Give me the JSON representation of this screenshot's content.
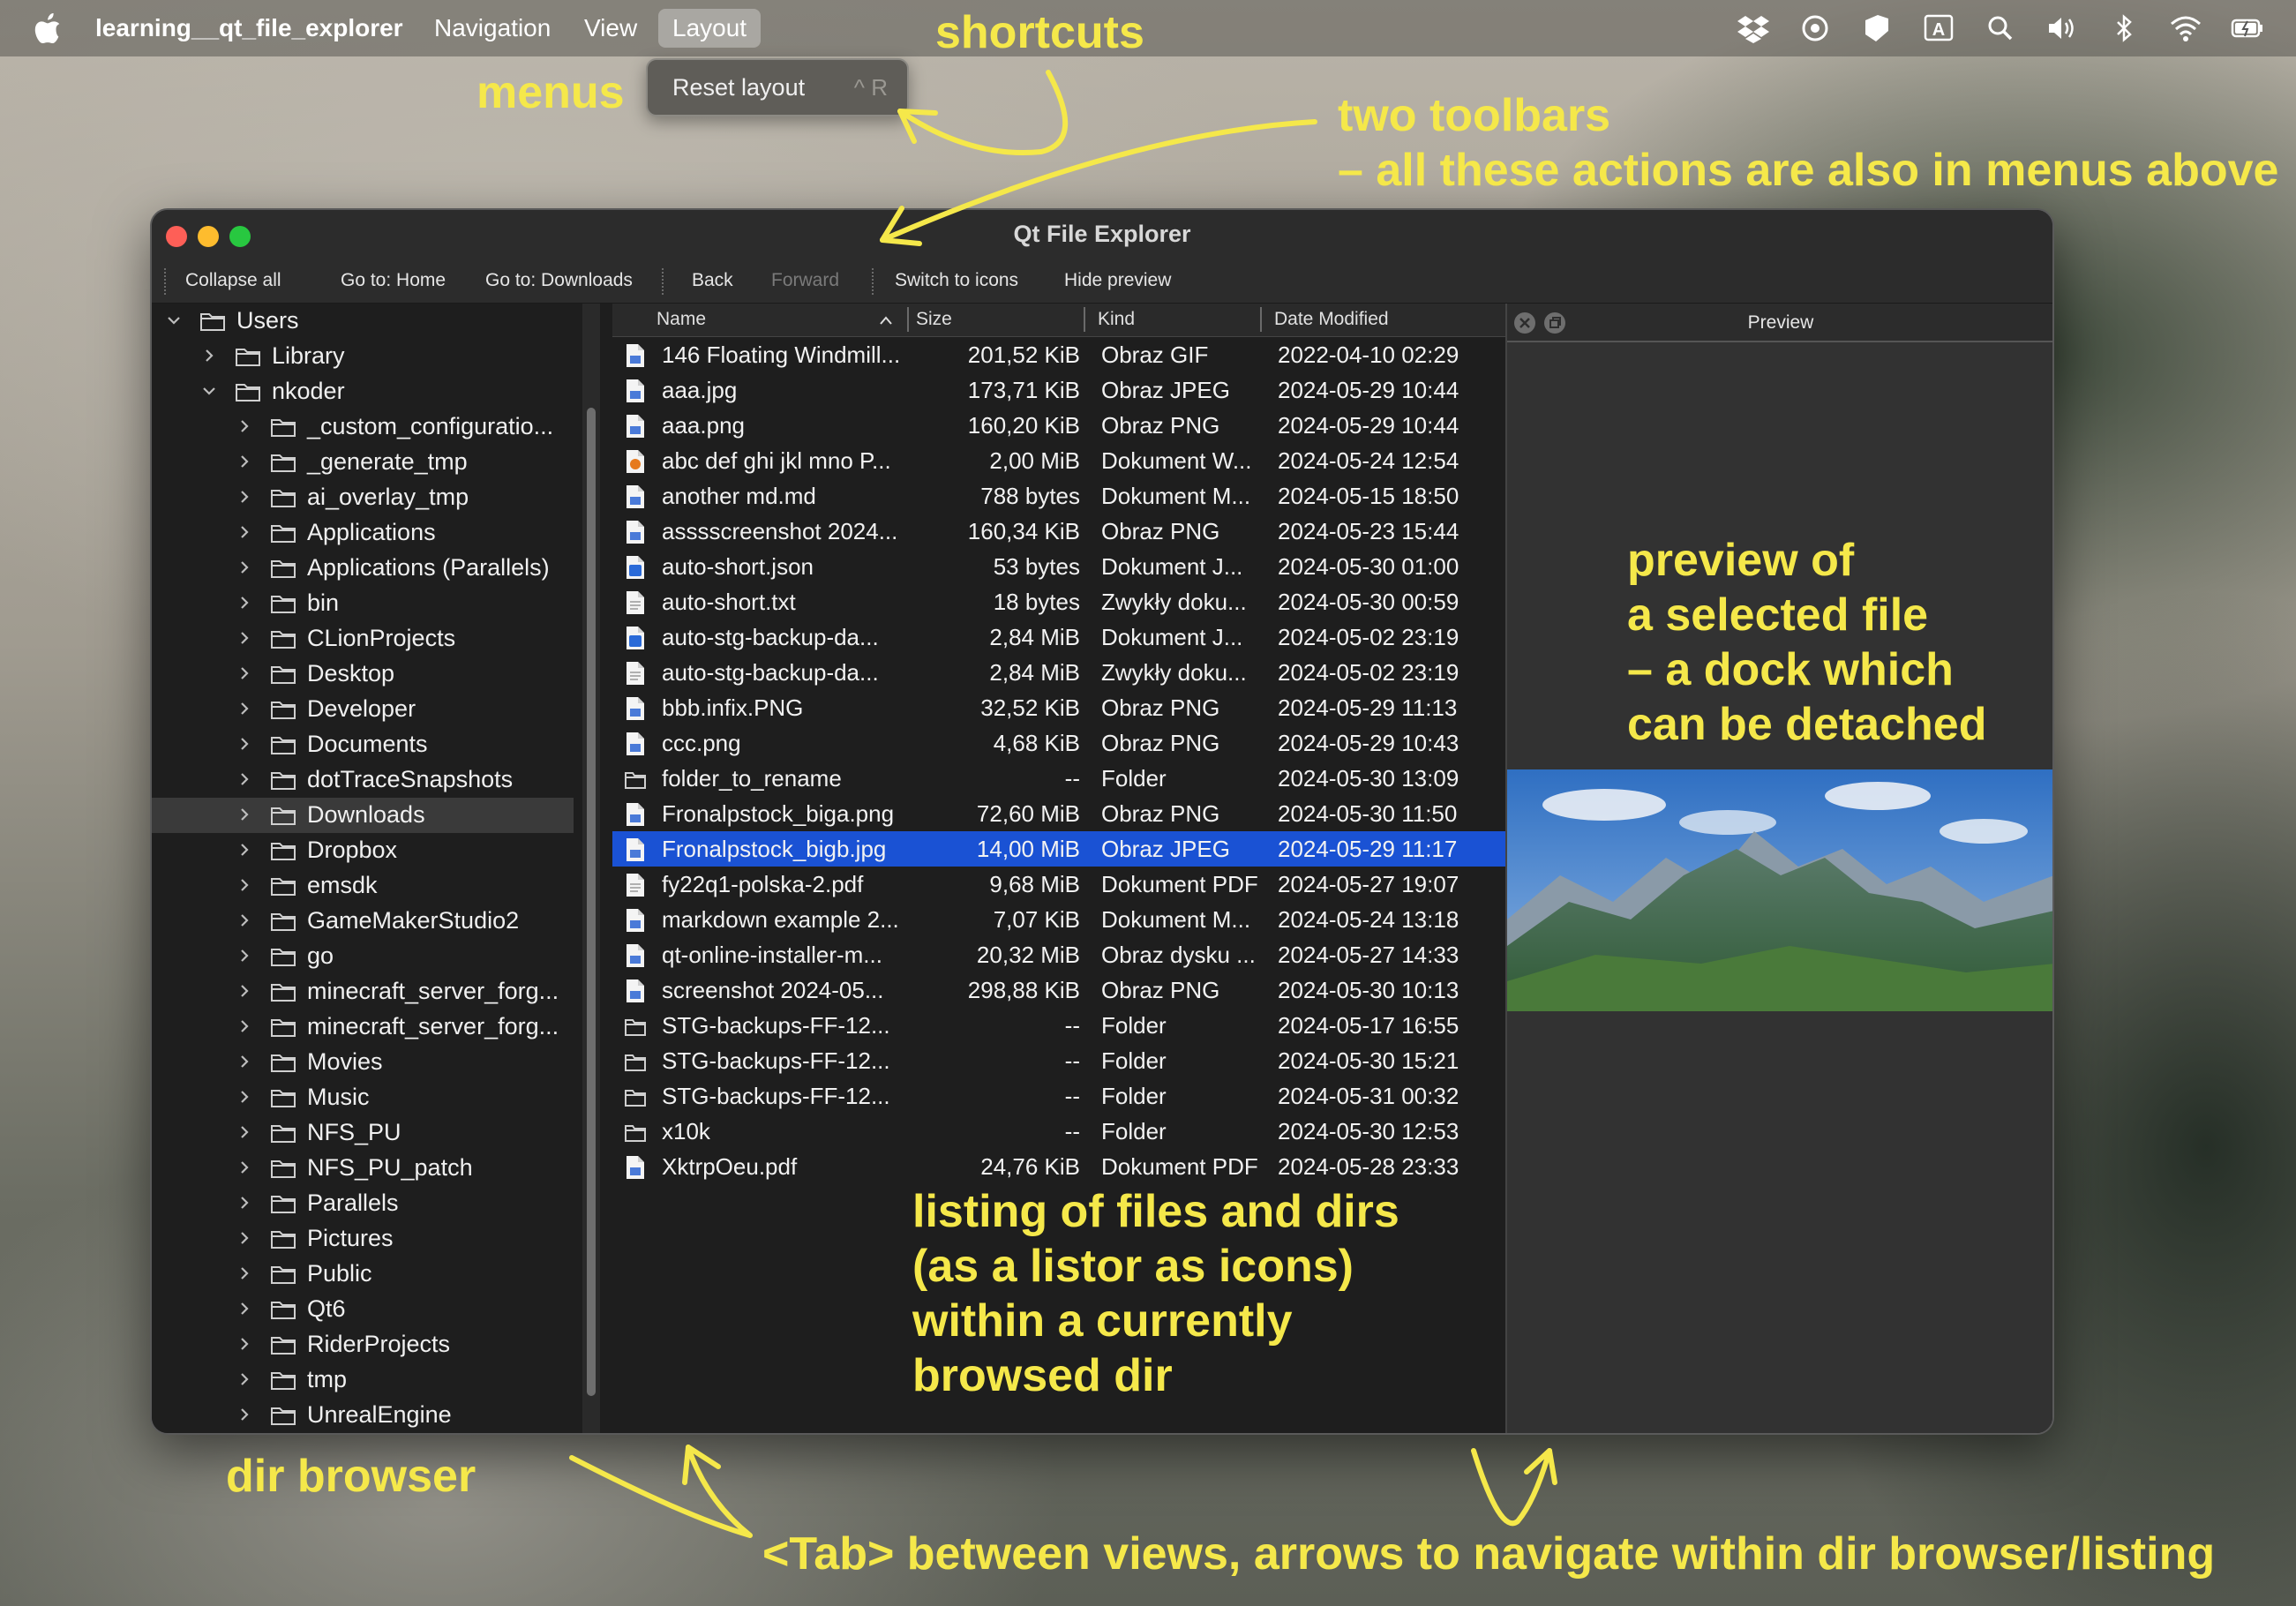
{
  "menubar": {
    "app_name": "learning__qt_file_explorer",
    "items": [
      "Navigation",
      "View",
      "Layout"
    ],
    "active_item": "Layout"
  },
  "dropdown": {
    "item_label": "Reset layout",
    "shortcut": "^ R"
  },
  "annotations": {
    "shortcuts": "shortcuts",
    "menus": "menus",
    "toolbars_line1": "two toolbars",
    "toolbars_line2": "– all these actions are also in menus above",
    "preview_lines": [
      "preview of",
      "a selected file",
      "– a dock which",
      "can be detached"
    ],
    "listing_lines": [
      "listing of files and dirs",
      "(as a listor as icons)",
      "within a currently",
      "browsed dir"
    ],
    "dir_browser": "dir browser",
    "tab_hint": "<Tab> between views, arrows to navigate within dir browser/listing"
  },
  "window": {
    "title": "Qt File Explorer",
    "toolbar1": [
      "Collapse all",
      "Go to: Home",
      "Go to: Downloads"
    ],
    "toolbar2": [
      {
        "label": "Back",
        "enabled": true
      },
      {
        "label": "Forward",
        "enabled": false
      },
      {
        "label": "Switch to icons",
        "enabled": true
      },
      {
        "label": "Hide preview",
        "enabled": true
      }
    ]
  },
  "tree": [
    {
      "name": "Users",
      "depth": 0,
      "expanded": true
    },
    {
      "name": "Library",
      "depth": 1,
      "expanded": false
    },
    {
      "name": "nkoder",
      "depth": 1,
      "expanded": true
    },
    {
      "name": "_custom_configuratio...",
      "depth": 2,
      "expanded": false
    },
    {
      "name": "_generate_tmp",
      "depth": 2,
      "expanded": false
    },
    {
      "name": "ai_overlay_tmp",
      "depth": 2,
      "expanded": false
    },
    {
      "name": "Applications",
      "depth": 2,
      "expanded": false
    },
    {
      "name": "Applications (Parallels)",
      "depth": 2,
      "expanded": false
    },
    {
      "name": "bin",
      "depth": 2,
      "expanded": false
    },
    {
      "name": "CLionProjects",
      "depth": 2,
      "expanded": false
    },
    {
      "name": "Desktop",
      "depth": 2,
      "expanded": false
    },
    {
      "name": "Developer",
      "depth": 2,
      "expanded": false
    },
    {
      "name": "Documents",
      "depth": 2,
      "expanded": false
    },
    {
      "name": "dotTraceSnapshots",
      "depth": 2,
      "expanded": false
    },
    {
      "name": "Downloads",
      "depth": 2,
      "expanded": false,
      "selected": true
    },
    {
      "name": "Dropbox",
      "depth": 2,
      "expanded": false
    },
    {
      "name": "emsdk",
      "depth": 2,
      "expanded": false
    },
    {
      "name": "GameMakerStudio2",
      "depth": 2,
      "expanded": false
    },
    {
      "name": "go",
      "depth": 2,
      "expanded": false
    },
    {
      "name": "minecraft_server_forg...",
      "depth": 2,
      "expanded": false
    },
    {
      "name": "minecraft_server_forg...",
      "depth": 2,
      "expanded": false
    },
    {
      "name": "Movies",
      "depth": 2,
      "expanded": false
    },
    {
      "name": "Music",
      "depth": 2,
      "expanded": false
    },
    {
      "name": "NFS_PU",
      "depth": 2,
      "expanded": false
    },
    {
      "name": "NFS_PU_patch",
      "depth": 2,
      "expanded": false
    },
    {
      "name": "Parallels",
      "depth": 2,
      "expanded": false
    },
    {
      "name": "Pictures",
      "depth": 2,
      "expanded": false
    },
    {
      "name": "Public",
      "depth": 2,
      "expanded": false
    },
    {
      "name": "Qt6",
      "depth": 2,
      "expanded": false
    },
    {
      "name": "RiderProjects",
      "depth": 2,
      "expanded": false
    },
    {
      "name": "tmp",
      "depth": 2,
      "expanded": false
    },
    {
      "name": "UnrealEngine",
      "depth": 2,
      "expanded": false
    }
  ],
  "listing": {
    "columns": [
      "Name",
      "Size",
      "Kind",
      "Date Modified"
    ],
    "rows": [
      {
        "name": "146 Floating Windmill...",
        "size": "201,52 KiB",
        "kind": "Obraz GIF",
        "date": "2022-04-10 02:29",
        "icon": "file"
      },
      {
        "name": "aaa.jpg",
        "size": "173,71 KiB",
        "kind": "Obraz JPEG",
        "date": "2024-05-29 10:44",
        "icon": "file"
      },
      {
        "name": "aaa.png",
        "size": "160,20 KiB",
        "kind": "Obraz PNG",
        "date": "2024-05-29 10:44",
        "icon": "file"
      },
      {
        "name": "abc def ghi jkl mno P...",
        "size": "2,00 MiB",
        "kind": "Dokument W...",
        "date": "2024-05-24 12:54",
        "icon": "orange"
      },
      {
        "name": "another md.md",
        "size": "788 bytes",
        "kind": "Dokument M...",
        "date": "2024-05-15 18:50",
        "icon": "file"
      },
      {
        "name": "asssscreenshot 2024...",
        "size": "160,34 KiB",
        "kind": "Obraz PNG",
        "date": "2024-05-23 15:44",
        "icon": "file"
      },
      {
        "name": "auto-short.json",
        "size": "53 bytes",
        "kind": "Dokument J...",
        "date": "2024-05-30 01:00",
        "icon": "blue"
      },
      {
        "name": "auto-short.txt",
        "size": "18 bytes",
        "kind": "Zwykły doku...",
        "date": "2024-05-30 00:59",
        "icon": "plain"
      },
      {
        "name": "auto-stg-backup-da...",
        "size": "2,84 MiB",
        "kind": "Dokument J...",
        "date": "2024-05-02 23:19",
        "icon": "blue"
      },
      {
        "name": "auto-stg-backup-da...",
        "size": "2,84 MiB",
        "kind": "Zwykły doku...",
        "date": "2024-05-02 23:19",
        "icon": "plain"
      },
      {
        "name": "bbb.infix.PNG",
        "size": "32,52 KiB",
        "kind": "Obraz PNG",
        "date": "2024-05-29 11:13",
        "icon": "file"
      },
      {
        "name": "ccc.png",
        "size": "4,68 KiB",
        "kind": "Obraz PNG",
        "date": "2024-05-29 10:43",
        "icon": "file"
      },
      {
        "name": "folder_to_rename",
        "size": "--",
        "kind": "Folder",
        "date": "2024-05-30 13:09",
        "icon": "folder"
      },
      {
        "name": "Fronalpstock_biga.png",
        "size": "72,60 MiB",
        "kind": "Obraz PNG",
        "date": "2024-05-30 11:50",
        "icon": "file"
      },
      {
        "name": "Fronalpstock_bigb.jpg",
        "size": "14,00 MiB",
        "kind": "Obraz JPEG",
        "date": "2024-05-29 11:17",
        "icon": "file",
        "selected": true
      },
      {
        "name": "fy22q1-polska-2.pdf",
        "size": "9,68 MiB",
        "kind": "Dokument PDF",
        "date": "2024-05-27 19:07",
        "icon": "plain"
      },
      {
        "name": "markdown example 2...",
        "size": "7,07 KiB",
        "kind": "Dokument M...",
        "date": "2024-05-24 13:18",
        "icon": "file"
      },
      {
        "name": "qt-online-installer-m...",
        "size": "20,32 MiB",
        "kind": "Obraz dysku ...",
        "date": "2024-05-27 14:33",
        "icon": "file"
      },
      {
        "name": "screenshot 2024-05...",
        "size": "298,88 KiB",
        "kind": "Obraz PNG",
        "date": "2024-05-30 10:13",
        "icon": "file"
      },
      {
        "name": "STG-backups-FF-12...",
        "size": "--",
        "kind": "Folder",
        "date": "2024-05-17 16:55",
        "icon": "folder"
      },
      {
        "name": "STG-backups-FF-12...",
        "size": "--",
        "kind": "Folder",
        "date": "2024-05-30 15:21",
        "icon": "folder"
      },
      {
        "name": "STG-backups-FF-12...",
        "size": "--",
        "kind": "Folder",
        "date": "2024-05-31 00:32",
        "icon": "folder"
      },
      {
        "name": "x10k",
        "size": "--",
        "kind": "Folder",
        "date": "2024-05-30 12:53",
        "icon": "folder"
      },
      {
        "name": "XktrpOeu.pdf",
        "size": "24,76 KiB",
        "kind": "Dokument PDF",
        "date": "2024-05-28 23:33",
        "icon": "file"
      }
    ]
  },
  "preview": {
    "title": "Preview"
  },
  "colors": {
    "annotation": "#f5e84a",
    "selection": "#1a52d4"
  }
}
